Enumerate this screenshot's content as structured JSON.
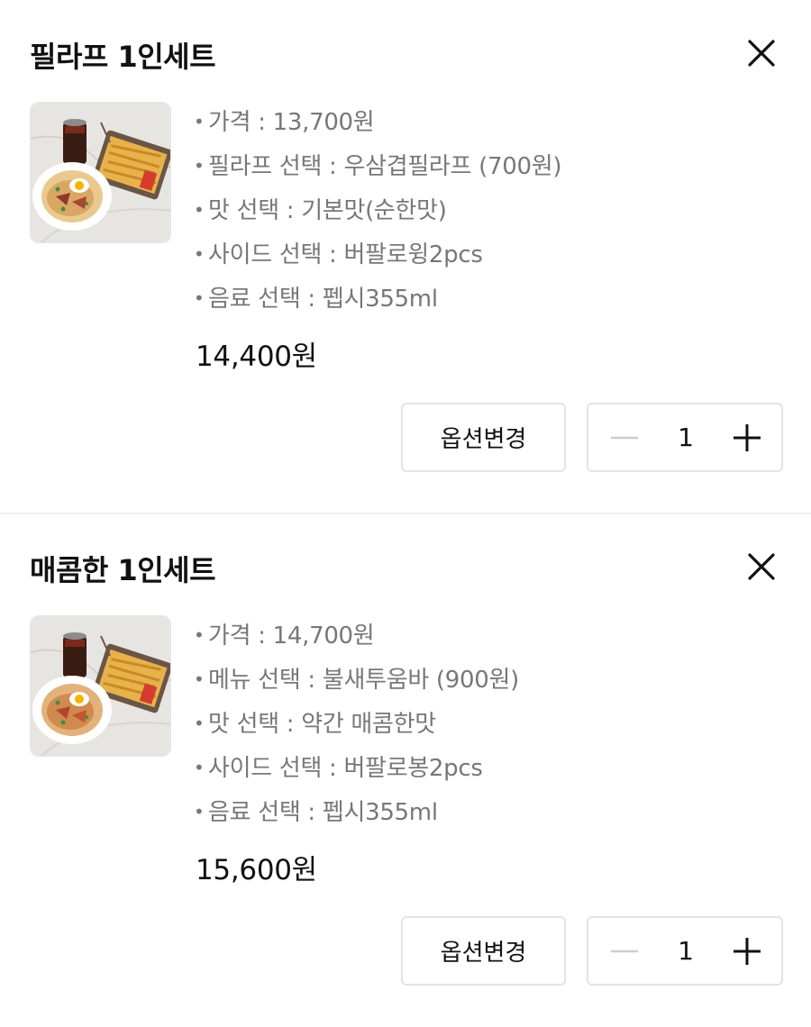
{
  "cart_items": [
    {
      "title": "필라프 1인세트",
      "image_alt": "pilaf-set-photo",
      "options": [
        "가격 : 13,700원",
        "필라프 선택 : 우삼겹필라프 (700원)",
        "맛 선택 : 기본맛(순한맛)",
        "사이드 선택 : 버팔로윙2pcs",
        "음료 선택 : 펩시355ml"
      ],
      "price": "14,400원",
      "option_change_label": "옵션변경",
      "quantity": "1"
    },
    {
      "title": "매콤한 1인세트",
      "image_alt": "spicy-set-photo",
      "options": [
        "가격 : 14,700원",
        "메뉴 선택 : 불새투움바 (900원)",
        "맛 선택 : 약간 매콤한맛",
        "사이드 선택 : 버팔로봉2pcs",
        "음료 선택 : 펩시355ml"
      ],
      "price": "15,600원",
      "option_change_label": "옵션변경",
      "quantity": "1"
    }
  ],
  "icons": {
    "close": "close-icon",
    "minus": "minus-icon",
    "plus": "plus-icon"
  },
  "colors": {
    "text_primary": "#111111",
    "text_secondary": "#777777",
    "border": "#e4e4e4",
    "minus_disabled": "#cccccc"
  }
}
